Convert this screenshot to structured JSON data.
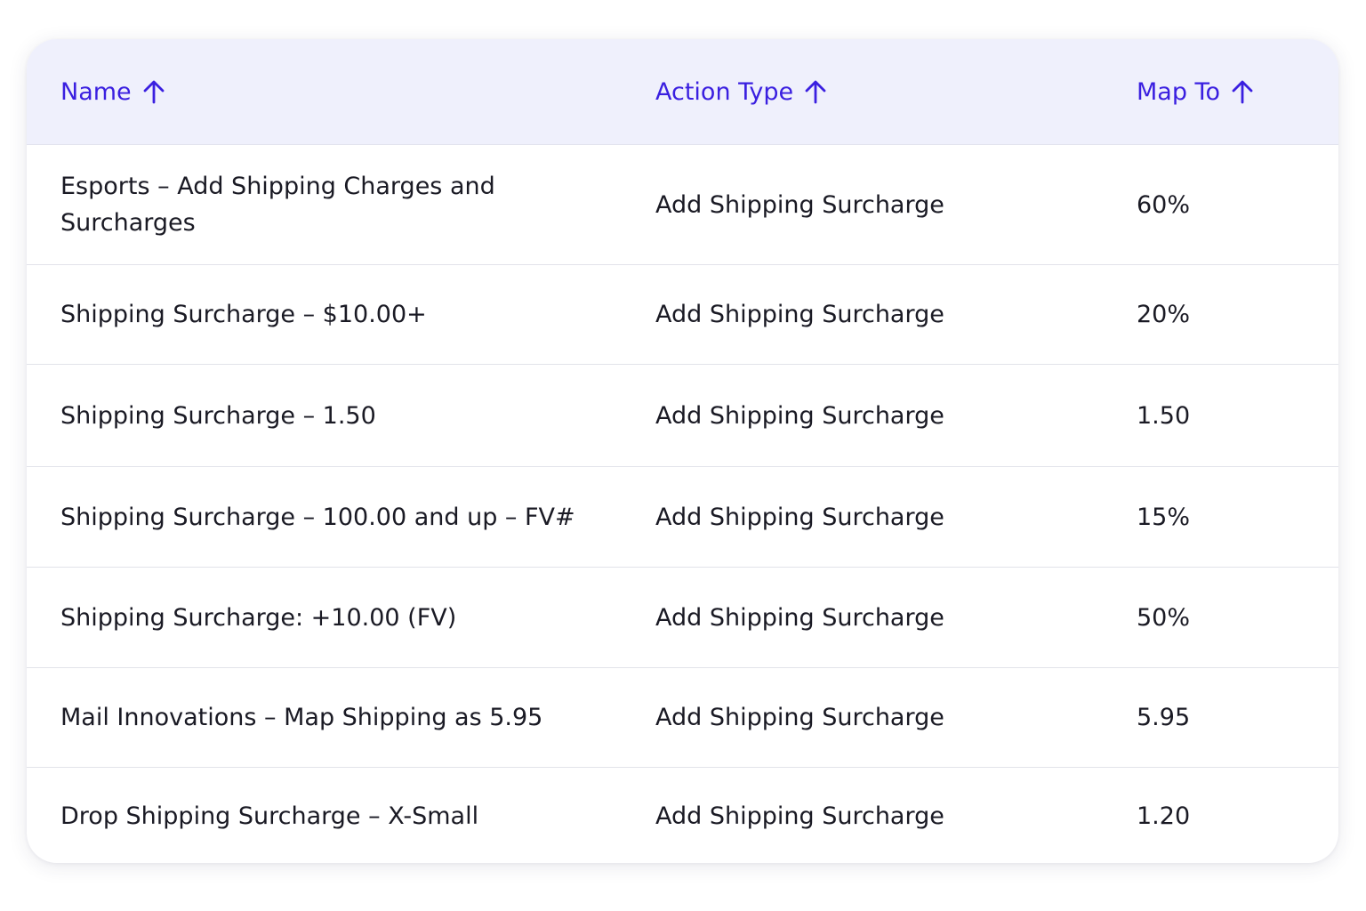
{
  "table": {
    "columns": [
      {
        "label": "Name",
        "sort": "ascending"
      },
      {
        "label": "Action Type",
        "sort": "ascending"
      },
      {
        "label": "Map To",
        "sort": "ascending"
      }
    ],
    "rows": [
      {
        "name": "Esports – Add Shipping Charges and Surcharges",
        "action_type": "Add Shipping Surcharge",
        "map_to": "60%"
      },
      {
        "name": "Shipping Surcharge – $10.00+",
        "action_type": "Add Shipping Surcharge",
        "map_to": "20%"
      },
      {
        "name": "Shipping Surcharge – 1.50",
        "action_type": "Add Shipping Surcharge",
        "map_to": "1.50"
      },
      {
        "name": "Shipping Surcharge – 100.00 and up – FV#",
        "action_type": "Add Shipping Surcharge",
        "map_to": "15%"
      },
      {
        "name": "Shipping Surcharge: +10.00 (FV)",
        "action_type": "Add Shipping Surcharge",
        "map_to": "50%"
      },
      {
        "name": "Mail Innovations – Map Shipping as 5.95",
        "action_type": "Add Shipping Surcharge",
        "map_to": "5.95"
      },
      {
        "name": "Drop Shipping Surcharge – X-Small",
        "action_type": "Add Shipping Surcharge",
        "map_to": "1.20"
      }
    ]
  },
  "colors": {
    "header_background": "#eff0fc",
    "header_text": "#3a1fe0",
    "body_text": "#1a1a24",
    "divider": "#e2e3ea"
  },
  "icons": {
    "sort": "arrow-up-icon"
  }
}
